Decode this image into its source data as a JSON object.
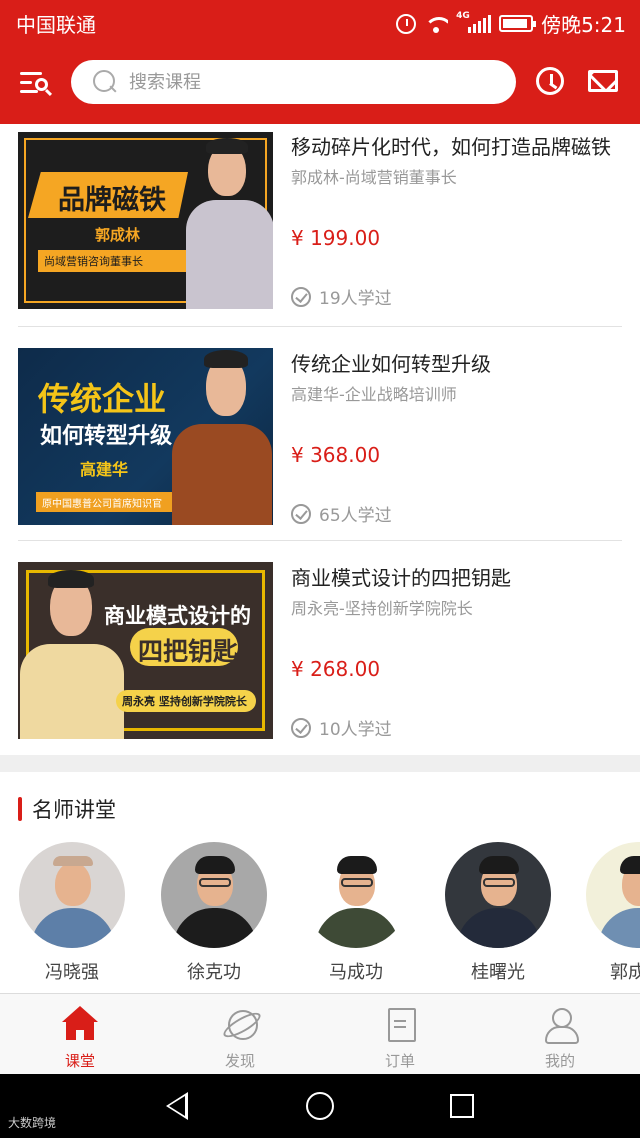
{
  "status_bar": {
    "carrier": "中国联通",
    "network": "4G",
    "time": "傍晚5:21"
  },
  "header": {
    "search_placeholder": "搜索课程",
    "icons": [
      "menu-search-icon",
      "history-icon",
      "mail-icon"
    ]
  },
  "courses": [
    {
      "title": "移动碎片化时代，如何打造品牌磁铁",
      "subtitle": "郭成林-尚域营销董事长",
      "price": "¥ 199.00",
      "learned": "19人学过",
      "thumb": {
        "title": "品牌磁铁",
        "name": "郭成林",
        "caption": "尚域营销咨询董事长"
      }
    },
    {
      "title": "传统企业如何转型升级",
      "subtitle": "高建华-企业战略培训师",
      "price": "¥ 368.00",
      "learned": "65人学过",
      "thumb": {
        "title": "传统企业",
        "line2": "如何转型升级",
        "name": "高建华",
        "caption": "原中国惠普公司首席知识官"
      }
    },
    {
      "title": "商业模式设计的四把钥匙",
      "subtitle": "周永亮-坚持创新学院院长",
      "price": "¥ 268.00",
      "learned": "10人学过",
      "thumb": {
        "title": "商业模式设计的",
        "line2": "四把钥匙",
        "name": "周永亮",
        "caption": "坚持创新学院院长"
      }
    }
  ],
  "teachers_section": {
    "title": "名师讲堂",
    "teachers": [
      {
        "name": "冯晓强"
      },
      {
        "name": "徐克功"
      },
      {
        "name": "马成功"
      },
      {
        "name": "桂曙光"
      },
      {
        "name": "郭成"
      }
    ]
  },
  "tabbar": {
    "tabs": [
      {
        "label": "课堂",
        "icon": "home-icon",
        "active": true
      },
      {
        "label": "发现",
        "icon": "planet-icon",
        "active": false
      },
      {
        "label": "订单",
        "icon": "order-icon",
        "active": false
      },
      {
        "label": "我的",
        "icon": "user-icon",
        "active": false
      }
    ]
  },
  "watermark": "大数跨境",
  "colors": {
    "brand": "#d91e18",
    "text": "#222222",
    "muted": "#999999"
  }
}
